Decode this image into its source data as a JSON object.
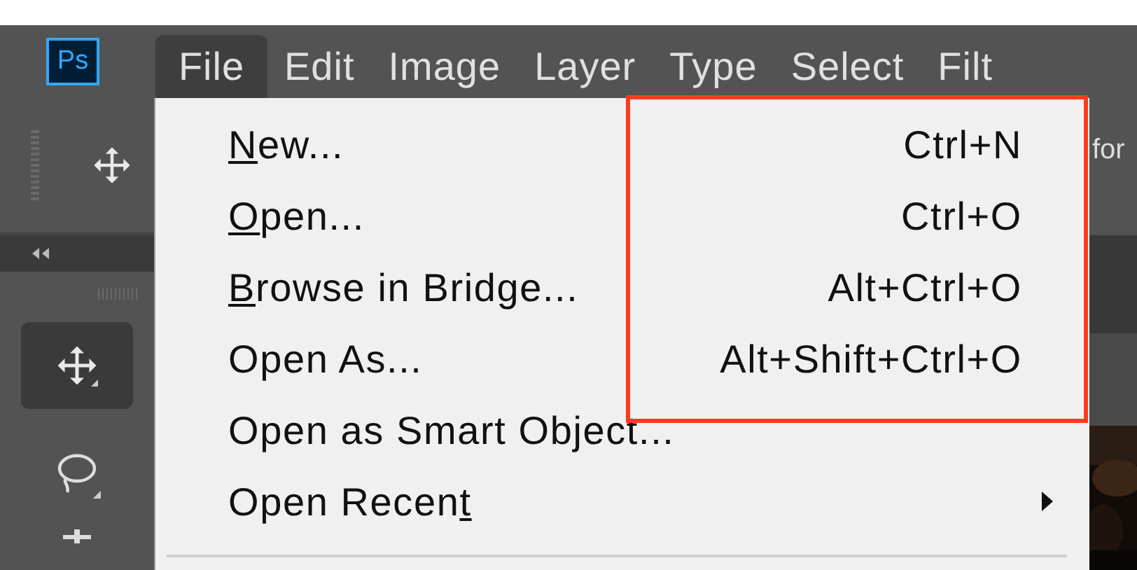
{
  "app_logo": "Ps",
  "menubar": [
    {
      "label": "File",
      "selected": true
    },
    {
      "label": "Edit",
      "selected": false
    },
    {
      "label": "Image",
      "selected": false
    },
    {
      "label": "Layer",
      "selected": false
    },
    {
      "label": "Type",
      "selected": false
    },
    {
      "label": "Select",
      "selected": false
    },
    {
      "label": "Filt",
      "selected": false
    }
  ],
  "file_menu": [
    {
      "label": [
        {
          "text": "N",
          "underline": true
        },
        {
          "text": "ew...",
          "underline": false
        }
      ],
      "shortcut": "Ctrl+N",
      "submenu": false
    },
    {
      "label": [
        {
          "text": "O",
          "underline": true
        },
        {
          "text": "pen...",
          "underline": false
        }
      ],
      "shortcut": "Ctrl+O",
      "submenu": false
    },
    {
      "label": [
        {
          "text": "B",
          "underline": true
        },
        {
          "text": "rowse in Bridge...",
          "underline": false
        }
      ],
      "shortcut": "Alt+Ctrl+O",
      "submenu": false
    },
    {
      "label": [
        {
          "text": "Open As...",
          "underline": false
        }
      ],
      "shortcut": "Alt+Shift+Ctrl+O",
      "submenu": false
    },
    {
      "label": [
        {
          "text": "Open as Smart Object...",
          "underline": false
        }
      ],
      "submenu": false
    },
    {
      "label": [
        {
          "text": "Open Recen",
          "underline": false
        },
        {
          "text": "t",
          "underline": true
        }
      ],
      "submenu": true
    }
  ],
  "options_bar_text": "for"
}
